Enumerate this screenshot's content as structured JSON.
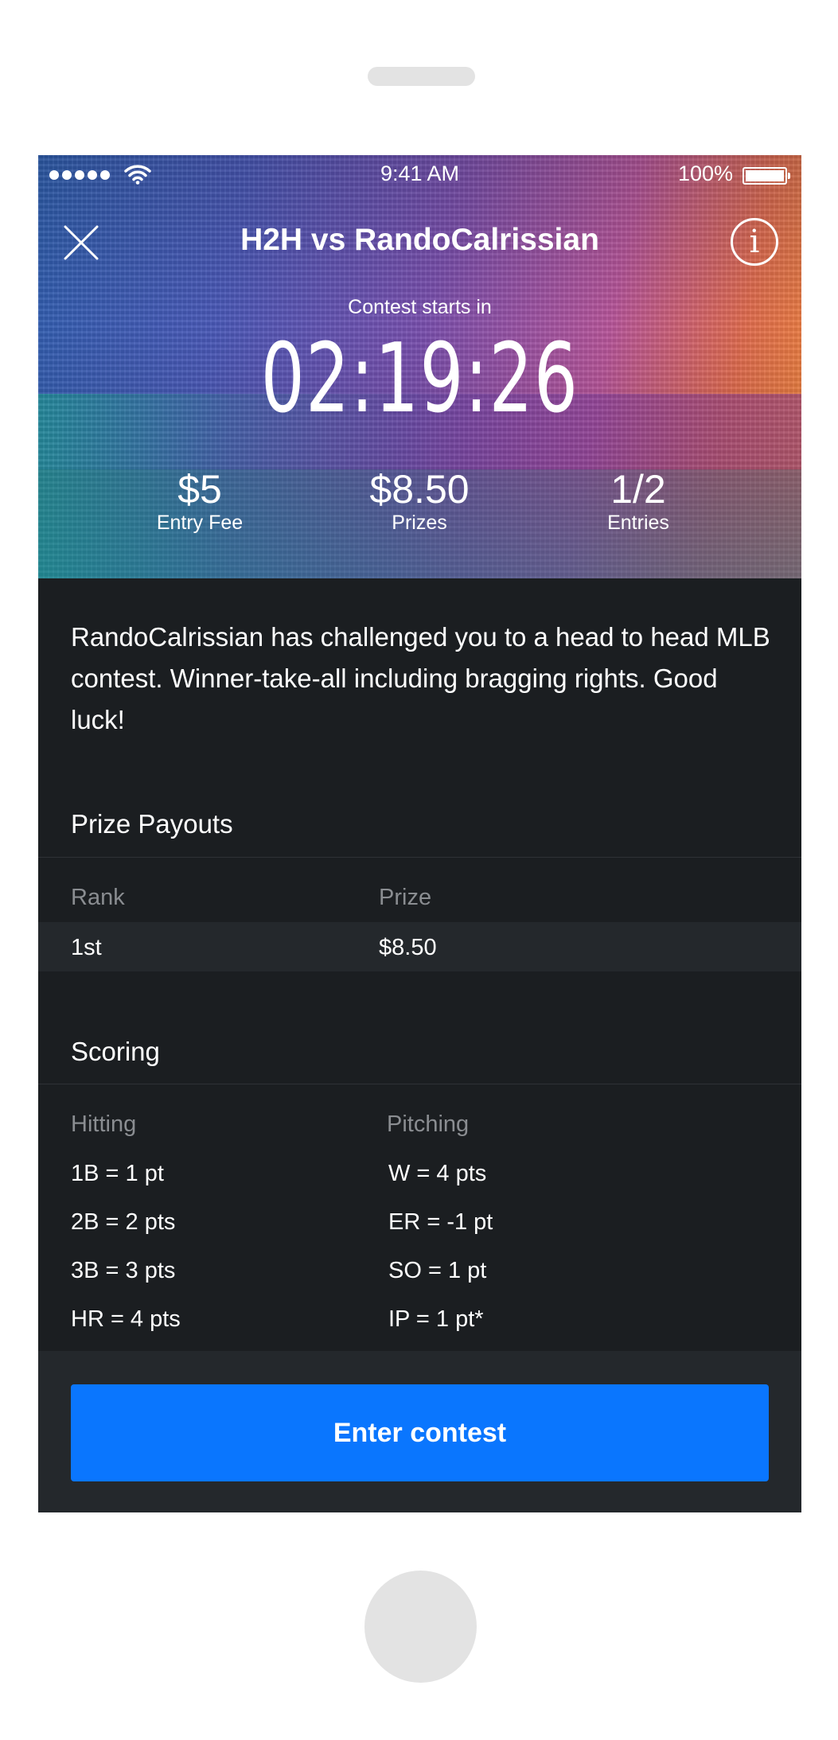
{
  "status_bar": {
    "time": "9:41 AM",
    "battery": "100%"
  },
  "header": {
    "title": "H2H vs RandoCalrissian"
  },
  "countdown": {
    "label": "Contest starts in",
    "value": "02:19:26"
  },
  "stats": {
    "entry_fee": {
      "value": "$5",
      "label": "Entry Fee"
    },
    "prizes": {
      "value": "$8.50",
      "label": "Prizes"
    },
    "entries": {
      "value": "1/2",
      "label": "Entries"
    }
  },
  "description": "RandoCalrissian has challenged you to a head to head MLB contest.  Winner-take-all including bragging rights.  Good luck!",
  "payouts": {
    "title": "Prize Payouts",
    "headers": {
      "rank": "Rank",
      "prize": "Prize"
    },
    "rows": [
      {
        "rank": "1st",
        "prize": "$8.50"
      }
    ]
  },
  "scoring": {
    "title": "Scoring",
    "hitting": {
      "label": "Hitting",
      "items": [
        "1B = 1 pt",
        "2B = 2 pts",
        "3B = 3 pts",
        "HR = 4 pts"
      ]
    },
    "pitching": {
      "label": "Pitching",
      "items": [
        "W = 4 pts",
        "ER = -1 pt",
        "SO = 1 pt",
        "IP = 1 pt*"
      ]
    }
  },
  "cta": {
    "label": "Enter contest",
    "color": "#0a76fe"
  },
  "icons": [
    "signal-dots-icon",
    "wifi-icon",
    "battery-icon",
    "close-icon",
    "info-icon"
  ]
}
